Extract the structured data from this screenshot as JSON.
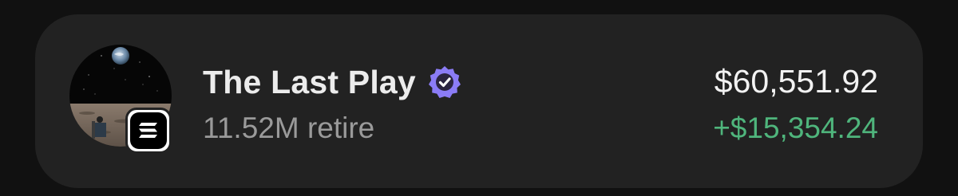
{
  "item": {
    "name": "The Last Play",
    "verified_icon": "verified-badge-icon",
    "holdings": "11.52M retire",
    "value": "$60,551.92",
    "change": "+$15,354.24",
    "chain_icon": "solana-icon",
    "avatar_icon": "moon-landscape-avatar"
  },
  "colors": {
    "background": "#111111",
    "card": "#222222",
    "verified": "#8b7cf6",
    "positive_change": "#4fb57c",
    "muted_text": "#9a9a9a"
  }
}
